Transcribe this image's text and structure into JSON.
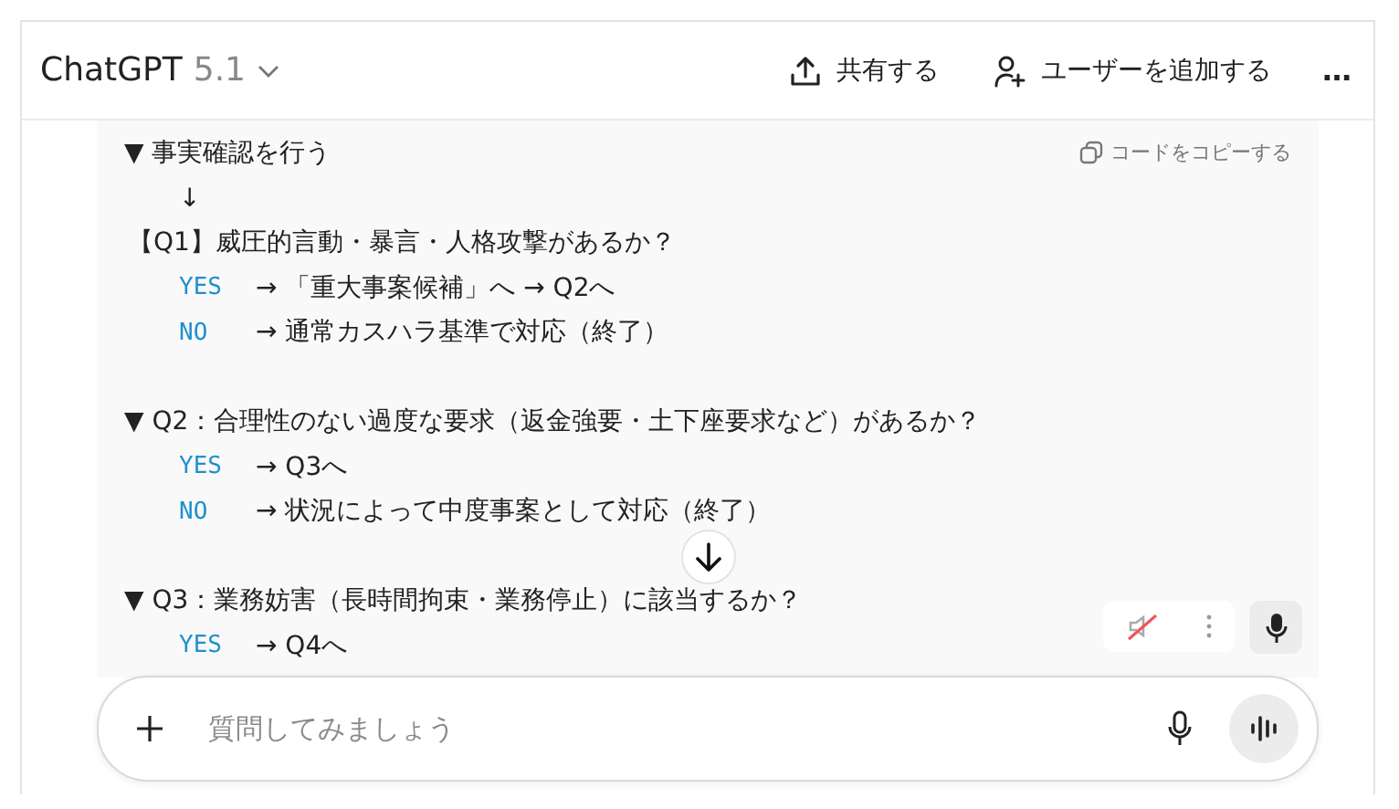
{
  "header": {
    "title": "ChatGPT",
    "version": "5.1",
    "actions": [
      {
        "kind": "share",
        "label": "共有する"
      },
      {
        "kind": "add-user",
        "label": "ユーザーを追加する"
      }
    ],
    "more": "…"
  },
  "code_block": {
    "copy_label": "コードをコピーする",
    "lines": [
      {
        "kind": "heading",
        "text": "▼ 事実確認を行う"
      },
      {
        "kind": "arrow",
        "text": "↓"
      },
      {
        "kind": "question",
        "text": "【Q1】威圧的言動・暴言・人格攻撃があるか？"
      },
      {
        "kind": "branch",
        "label": "YES",
        "text": "→ 「重大事案候補」へ → Q2へ"
      },
      {
        "kind": "branch",
        "label": "NO",
        "text": "→ 通常カスハラ基準で対応（終了）"
      },
      {
        "kind": "blank"
      },
      {
        "kind": "heading",
        "text": "▼ Q2：合理性のない過度な要求（返金強要・土下座要求など）があるか？"
      },
      {
        "kind": "branch",
        "label": "YES",
        "text": "→ Q3へ"
      },
      {
        "kind": "branch",
        "label": "NO",
        "text": "→ 状況によって中度事案として対応（終了）"
      },
      {
        "kind": "blank"
      },
      {
        "kind": "heading",
        "text": "▼ Q3：業務妨害（長時間拘束・業務停止）に該当するか？"
      },
      {
        "kind": "branch",
        "label": "YES",
        "text": "→ Q4へ"
      }
    ]
  },
  "composer": {
    "placeholder": "質問してみましょう"
  }
}
